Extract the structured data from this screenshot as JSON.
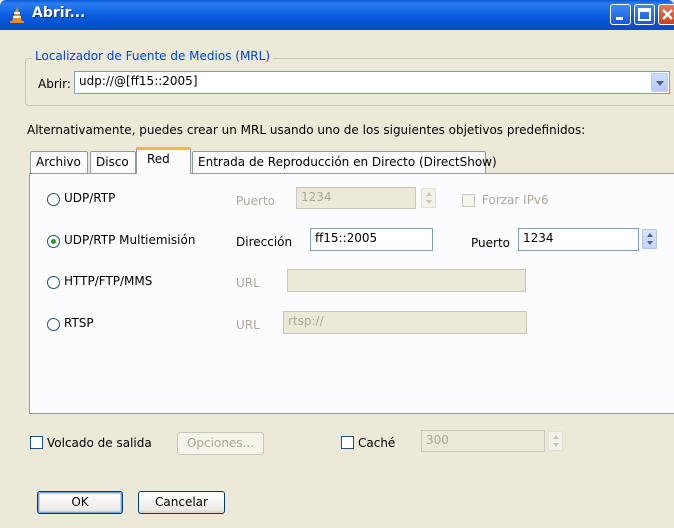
{
  "window": {
    "title": "Abrir..."
  },
  "mrl": {
    "group_title": "Localizador de Fuente de Medios (MRL)",
    "open_label": "Abrir:",
    "open_value": "udp://@[ff15::2005]"
  },
  "alt_text": "Alternativamente, puedes crear un MRL usando uno de los siguientes objetivos predefinidos:",
  "tabs": [
    {
      "label": "Archivo"
    },
    {
      "label": "Disco"
    },
    {
      "label": "Red"
    },
    {
      "label": "Entrada de Reproducción en Directo (DirectShow)"
    }
  ],
  "network": {
    "udp": {
      "label": "UDP/RTP",
      "port_label": "Puerto",
      "port_value": "1234",
      "ipv6_label": "Forzar IPv6"
    },
    "multicast": {
      "label": "UDP/RTP Multiemisión",
      "address_label": "Dirección",
      "address_value": "ff15::2005",
      "port_label": "Puerto",
      "port_value": "1234"
    },
    "http": {
      "label": "HTTP/FTP/MMS",
      "url_label": "URL",
      "url_value": ""
    },
    "rtsp": {
      "label": "RTSP",
      "url_label": "URL",
      "url_value": "rtsp://"
    }
  },
  "output": {
    "dump_label": "Volcado de salida",
    "options_label": "Opciones...",
    "cache_label": "Caché",
    "cache_value": "300"
  },
  "buttons": {
    "ok": "OK",
    "cancel": "Cancelar"
  }
}
